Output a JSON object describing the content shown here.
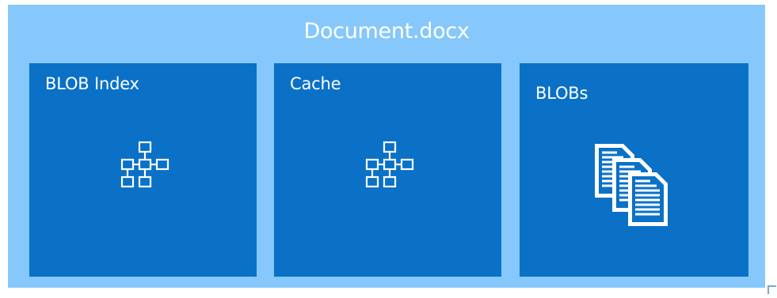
{
  "frame": {
    "title": "Document.docx"
  },
  "panels": [
    {
      "label": "BLOB Index",
      "icon": "network-icon"
    },
    {
      "label": "Cache",
      "icon": "network-icon"
    },
    {
      "label": "BLOBs",
      "icon": "documents-icon"
    }
  ],
  "colors": {
    "frame_bg": "#86c8fb",
    "panel_bg": "#0a71c7",
    "text": "#ffffff"
  }
}
